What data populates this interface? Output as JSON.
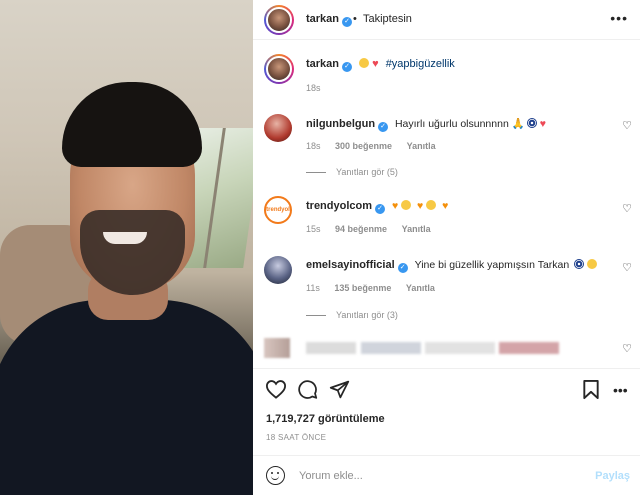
{
  "post": {
    "username": "tarkan",
    "follow_dot": "•",
    "follow_status": "Takiptesin",
    "more_label": "•••"
  },
  "caption": {
    "username": "tarkan",
    "hashtag": "#yapbigüzellik",
    "time": "18s"
  },
  "comments": [
    {
      "username": "nilgunbelgun",
      "text": "Hayırlı uğurlu olsunnnnn",
      "time": "18s",
      "likes": "300 beğenme",
      "reply": "Yanıtla",
      "replies_label": "Yanıtları gör (5)",
      "avatar_color": "#c0392b"
    },
    {
      "username": "trendyolcom",
      "text": "",
      "time": "15s",
      "likes": "94 beğenme",
      "reply": "Yanıtla",
      "avatar_color": "#f27a1a",
      "avatar_text": "trendyol"
    },
    {
      "username": "emelsayinofficial",
      "text": "Yine bi güzellik yapmışsın Tarkan",
      "time": "11s",
      "likes": "135 beğenme",
      "reply": "Yanıtla",
      "replies_label": "Yanıtları gör (3)",
      "avatar_color": "#3d4a6b"
    }
  ],
  "stats": {
    "views": "1,719,727 görüntüleme",
    "ago": "18 SAAT ÖNCE"
  },
  "comment_box": {
    "placeholder": "Yorum ekle...",
    "post_label": "Paylaş"
  },
  "icons": {
    "like": "heart-icon",
    "comment": "comment-icon",
    "share": "send-icon",
    "save": "bookmark-icon",
    "emoji": "smiley-icon",
    "comment_like": "heart-outline-icon"
  },
  "colors": {
    "verified": "#3897f0",
    "hashtag": "#00376b",
    "muted": "#8e8e8e",
    "post_button_disabled": "#b2dffc"
  }
}
